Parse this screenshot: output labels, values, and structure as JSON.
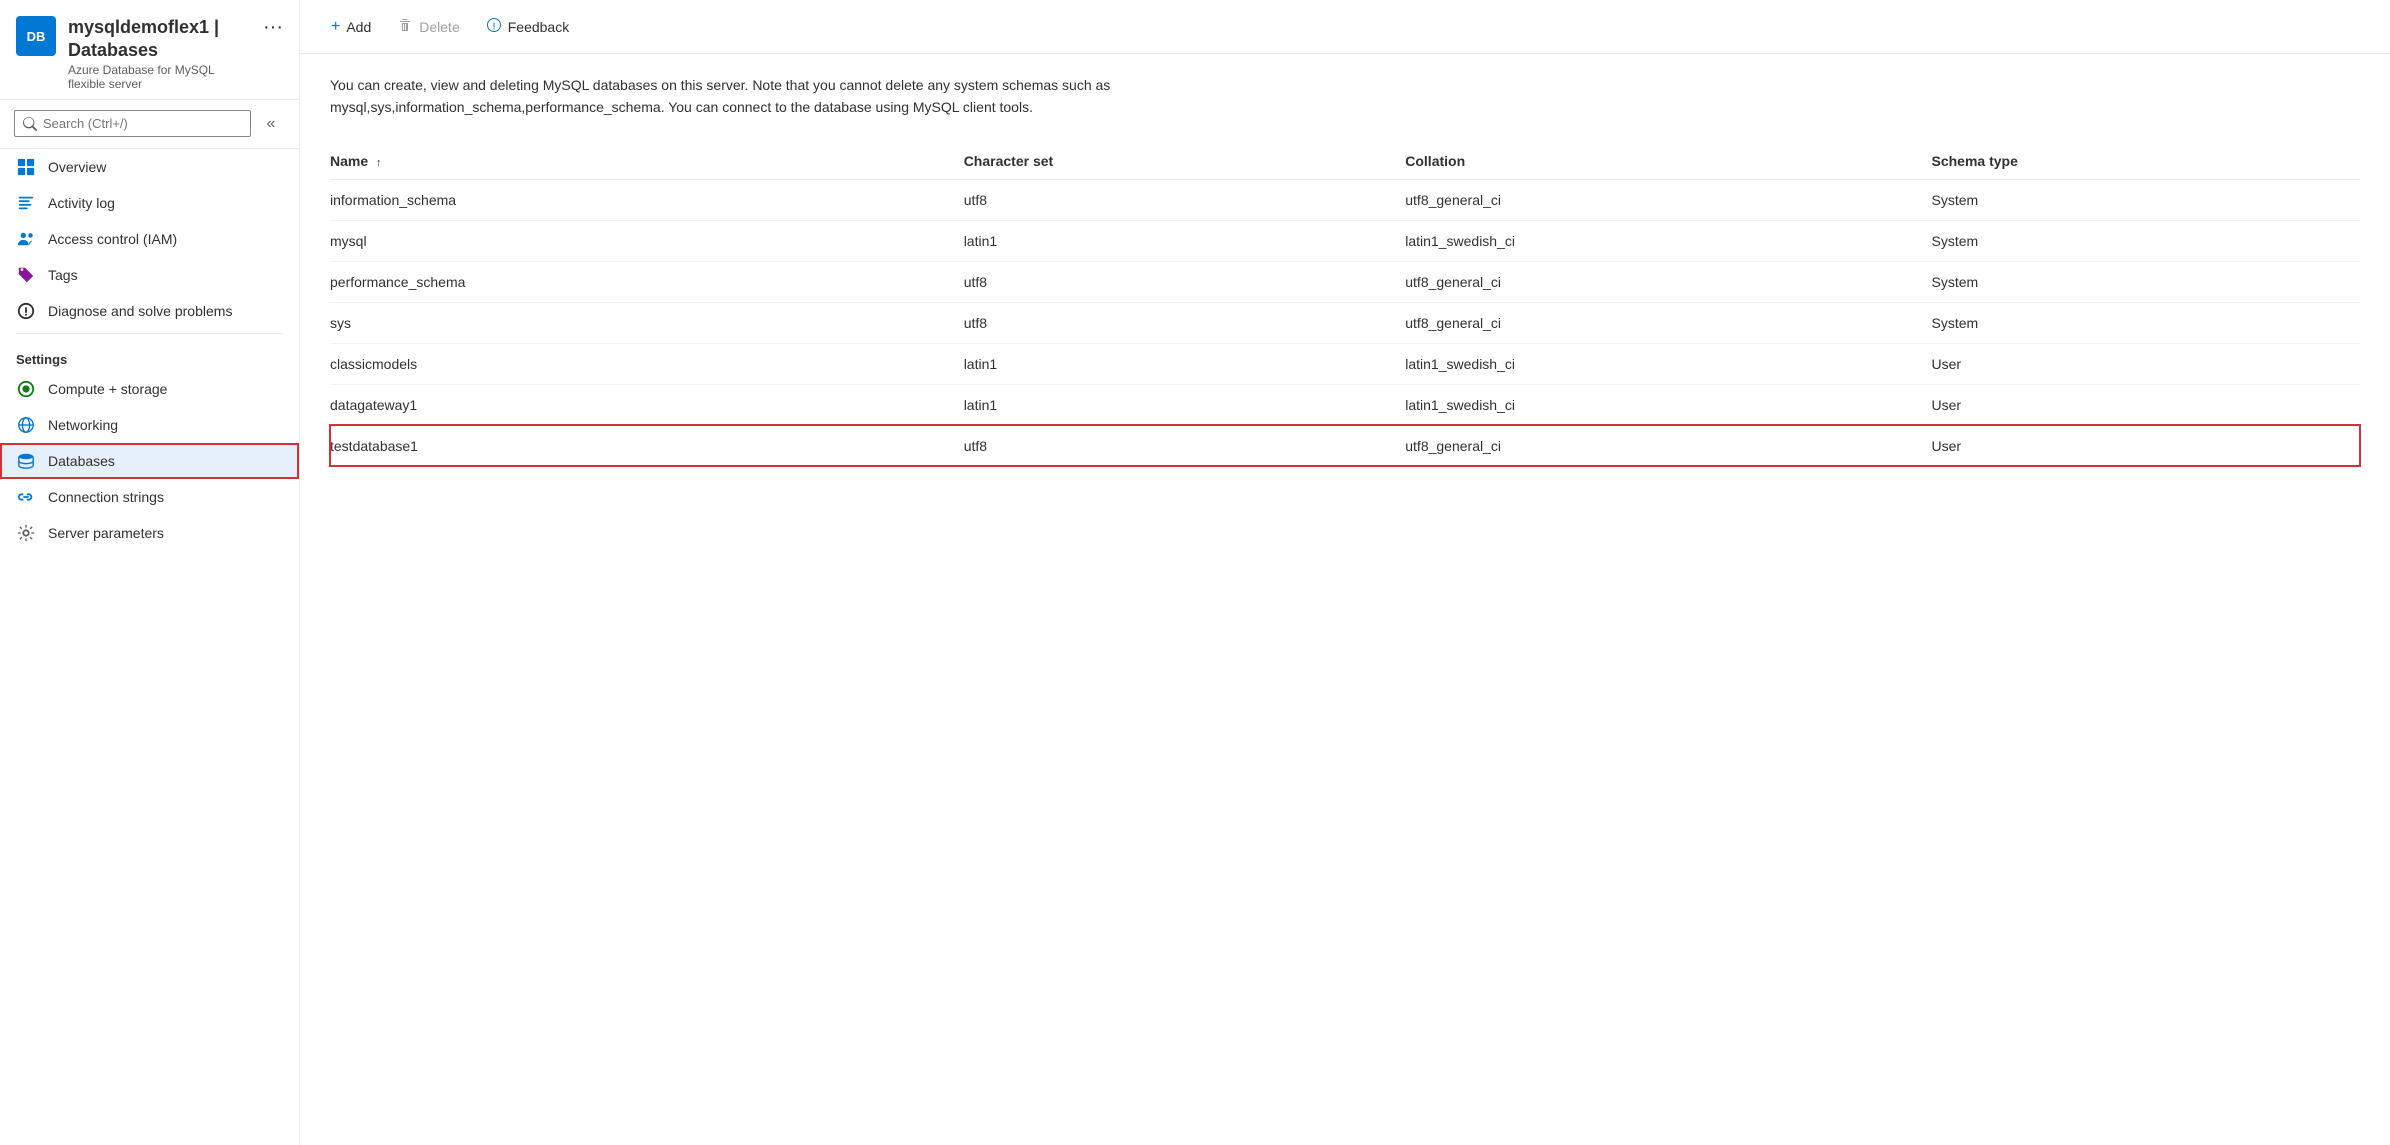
{
  "header": {
    "title": "mysqldemoflex1 | Databases",
    "subtitle": "Azure Database for MySQL flexible server",
    "icon_text": "DB",
    "close_label": "×",
    "dots_label": "···"
  },
  "search": {
    "placeholder": "Search (Ctrl+/)"
  },
  "collapse_icon": "«",
  "sidebar": {
    "nav_items": [
      {
        "id": "overview",
        "label": "Overview",
        "icon": "my_icon"
      },
      {
        "id": "activity-log",
        "label": "Activity log",
        "icon": "activity_icon"
      },
      {
        "id": "access-control",
        "label": "Access control (IAM)",
        "icon": "access_icon"
      },
      {
        "id": "tags",
        "label": "Tags",
        "icon": "tags_icon"
      },
      {
        "id": "diagnose",
        "label": "Diagnose and solve problems",
        "icon": "diagnose_icon"
      }
    ],
    "settings_label": "Settings",
    "settings_items": [
      {
        "id": "compute-storage",
        "label": "Compute + storage",
        "icon": "compute_icon"
      },
      {
        "id": "networking",
        "label": "Networking",
        "icon": "networking_icon"
      },
      {
        "id": "databases",
        "label": "Databases",
        "icon": "db_icon",
        "active": true
      },
      {
        "id": "connection-strings",
        "label": "Connection strings",
        "icon": "connection_icon"
      },
      {
        "id": "server-parameters",
        "label": "Server parameters",
        "icon": "server_icon"
      }
    ]
  },
  "toolbar": {
    "add_label": "Add",
    "delete_label": "Delete",
    "feedback_label": "Feedback"
  },
  "content": {
    "description": "You can create, view and deleting MySQL databases on this server. Note that you cannot delete any system schemas such as mysql,sys,information_schema,performance_schema. You can connect to the database using MySQL client tools.",
    "table": {
      "columns": [
        {
          "id": "name",
          "label": "Name",
          "sort": "↑"
        },
        {
          "id": "charset",
          "label": "Character set"
        },
        {
          "id": "collation",
          "label": "Collation"
        },
        {
          "id": "schema_type",
          "label": "Schema type"
        }
      ],
      "rows": [
        {
          "name": "information_schema",
          "charset": "utf8",
          "collation": "utf8_general_ci",
          "schema_type": "System",
          "highlighted": false
        },
        {
          "name": "mysql",
          "charset": "latin1",
          "collation": "latin1_swedish_ci",
          "schema_type": "System",
          "highlighted": false
        },
        {
          "name": "performance_schema",
          "charset": "utf8",
          "collation": "utf8_general_ci",
          "schema_type": "System",
          "highlighted": false
        },
        {
          "name": "sys",
          "charset": "utf8",
          "collation": "utf8_general_ci",
          "schema_type": "System",
          "highlighted": false
        },
        {
          "name": "classicmodels",
          "charset": "latin1",
          "collation": "latin1_swedish_ci",
          "schema_type": "User",
          "highlighted": false
        },
        {
          "name": "datagateway1",
          "charset": "latin1",
          "collation": "latin1_swedish_ci",
          "schema_type": "User",
          "highlighted": false
        },
        {
          "name": "testdatabase1",
          "charset": "utf8",
          "collation": "utf8_general_ci",
          "schema_type": "User",
          "highlighted": true
        }
      ]
    }
  }
}
